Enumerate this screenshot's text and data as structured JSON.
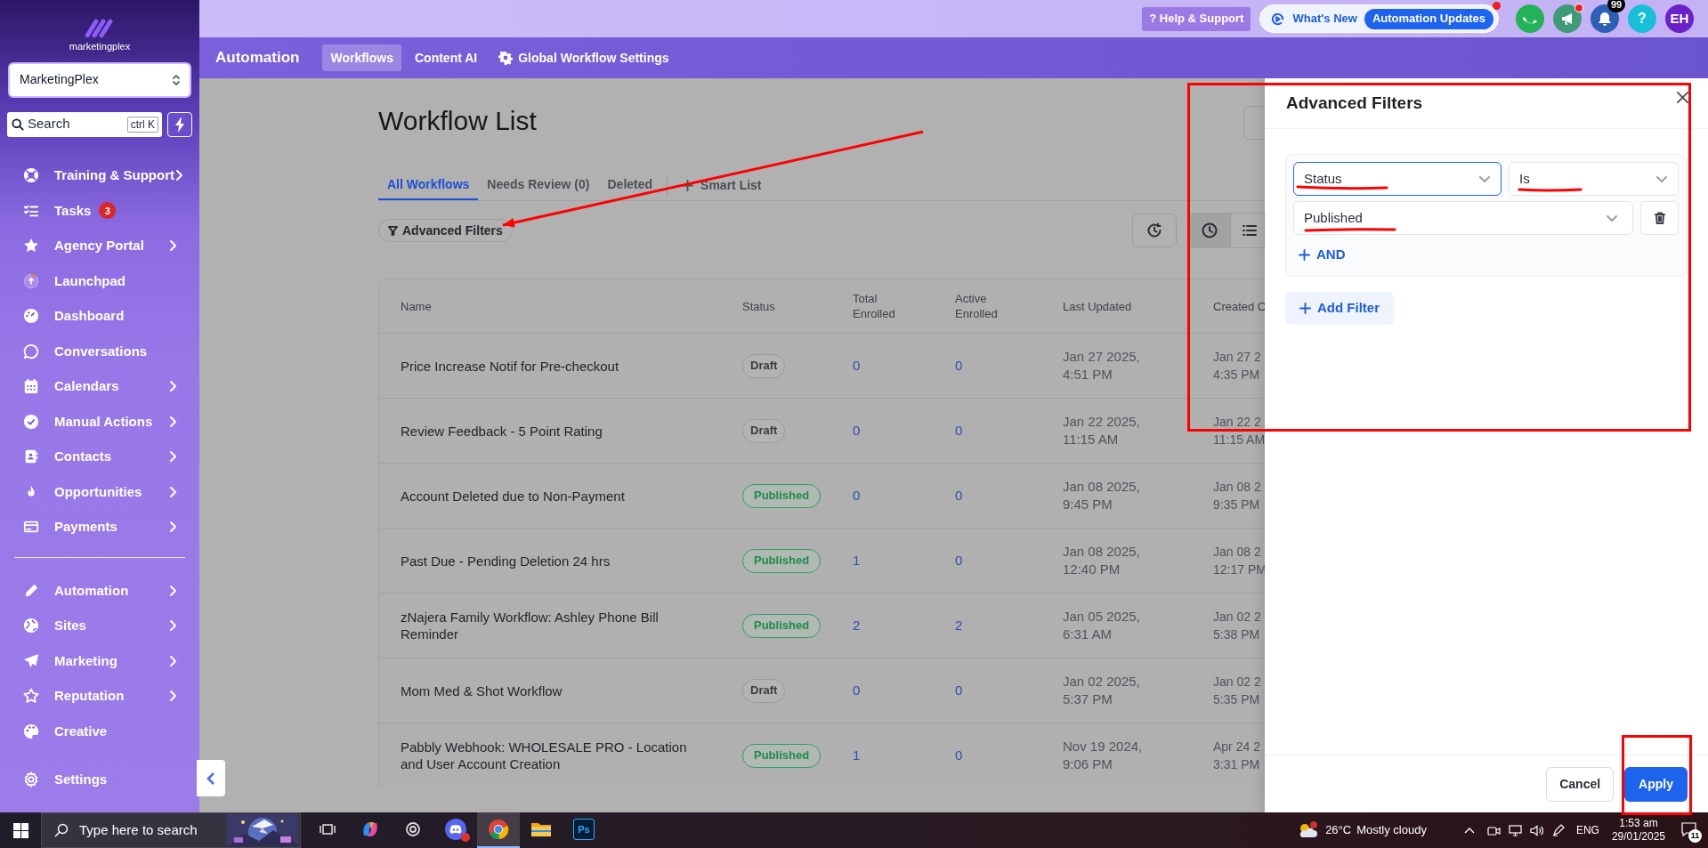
{
  "sidebar": {
    "logo": "marketingplex",
    "account": "MarketingPlex",
    "search": {
      "placeholder": "Search",
      "shortcut": "ctrl K"
    },
    "sections": [
      {
        "divider_before": false,
        "items": [
          {
            "label": "Training & Support",
            "submenu": true
          },
          {
            "label": "Tasks",
            "submenu": false,
            "badge": "3"
          },
          {
            "label": "Agency Portal",
            "submenu": true
          },
          {
            "label": "Launchpad",
            "submenu": false
          },
          {
            "label": "Dashboard",
            "submenu": false
          },
          {
            "label": "Conversations",
            "submenu": false
          },
          {
            "label": "Calendars",
            "submenu": true
          },
          {
            "label": "Manual Actions",
            "submenu": true
          },
          {
            "label": "Contacts",
            "submenu": true
          },
          {
            "label": "Opportunities",
            "submenu": true
          },
          {
            "label": "Payments",
            "submenu": true
          }
        ]
      },
      {
        "divider_before": true,
        "items": [
          {
            "label": "Automation",
            "submenu": true
          },
          {
            "label": "Sites",
            "submenu": true
          },
          {
            "label": "Marketing",
            "submenu": true
          },
          {
            "label": "Reputation",
            "submenu": true
          },
          {
            "label": "Creative",
            "submenu": false
          }
        ]
      },
      {
        "divider_before": false,
        "items": [
          {
            "label": "Settings",
            "submenu": false
          }
        ]
      }
    ]
  },
  "topbar": {
    "help": "? Help & Support",
    "whats_new": {
      "label": "What's New",
      "badge": "Automation Updates",
      "dot": true
    },
    "actions": [
      {
        "kind": "phone",
        "color": "#22b35a"
      },
      {
        "kind": "announce",
        "color": "#3f9a78",
        "dot": true
      },
      {
        "kind": "notifications",
        "color": "#2c5fb5",
        "badge": "99"
      },
      {
        "kind": "help",
        "color": "#17c0d8",
        "text": "?"
      },
      {
        "kind": "avatar",
        "color": "#6b21c8",
        "text": "EH"
      }
    ]
  },
  "subnav": {
    "title": "Automation",
    "tabs": [
      {
        "label": "Workflows",
        "selected": true,
        "gear": false
      },
      {
        "label": "Content AI",
        "selected": false,
        "gear": false
      },
      {
        "label": "Global Workflow Settings",
        "selected": false,
        "gear": true
      }
    ]
  },
  "page": {
    "title": "Workflow List",
    "tabs": [
      {
        "label": "All Workflows",
        "selected": true
      },
      {
        "label": "Needs Review (0)",
        "selected": false
      },
      {
        "label": "Deleted",
        "selected": false
      }
    ],
    "smart_list": "Smart List",
    "filter_button": "Advanced Filters",
    "view_toggle": [
      {
        "selected": true
      },
      {
        "selected": false
      }
    ],
    "table": {
      "columns": [
        "Name",
        "Status",
        "Total Enrolled",
        "Active Enrolled",
        "Last Updated",
        "Created O"
      ],
      "rows": [
        {
          "name": "Price Increase Notif for Pre-checkout",
          "status": {
            "label": "Draft",
            "kind": "draft"
          },
          "total": "0",
          "active": "0",
          "updated": [
            "Jan 27 2025,",
            "4:51 PM"
          ],
          "created": [
            "Jan 27 2",
            "4:35 PM"
          ]
        },
        {
          "name": "Review Feedback - 5 Point Rating",
          "status": {
            "label": "Draft",
            "kind": "draft"
          },
          "total": "0",
          "active": "0",
          "updated": [
            "Jan 22 2025,",
            "11:15 AM"
          ],
          "created": [
            "Jan 22 2",
            "11:15 AM"
          ]
        },
        {
          "name": "Account Deleted due to Non-Payment",
          "status": {
            "label": "Published",
            "kind": "published"
          },
          "total": "0",
          "active": "0",
          "updated": [
            "Jan 08 2025,",
            "9:45 PM"
          ],
          "created": [
            "Jan 08 2",
            "9:35 PM"
          ]
        },
        {
          "name": "Past Due - Pending Deletion 24 hrs",
          "status": {
            "label": "Published",
            "kind": "published"
          },
          "total": "1",
          "active": "0",
          "updated": [
            "Jan 08 2025,",
            "12:40 PM"
          ],
          "created": [
            "Jan 08 2",
            "12:17 PM"
          ]
        },
        {
          "name": "zNajera Family Workflow: Ashley Phone Bill Reminder",
          "status": {
            "label": "Published",
            "kind": "published"
          },
          "total": "2",
          "active": "2",
          "updated": [
            "Jan 05 2025,",
            "6:31 AM"
          ],
          "created": [
            "Jan 02 2",
            "5:38 PM"
          ]
        },
        {
          "name": "Mom Med & Shot Workflow",
          "status": {
            "label": "Draft",
            "kind": "draft"
          },
          "total": "0",
          "active": "0",
          "updated": [
            "Jan 02 2025,",
            "5:37 PM"
          ],
          "created": [
            "Jan 02 2",
            "5:35 PM"
          ]
        },
        {
          "name": "Pabbly Webhook: WHOLESALE PRO - Location and User Account Creation",
          "status": {
            "label": "Published",
            "kind": "published"
          },
          "total": "1",
          "active": "0",
          "updated": [
            "Nov 19 2024,",
            "9:06 PM"
          ],
          "created": [
            "Apr 24 2",
            "3:31 PM"
          ]
        }
      ]
    }
  },
  "drawer": {
    "title": "Advanced Filters",
    "filters": [
      {
        "field": "Status",
        "operator": "Is",
        "value": "Published",
        "field_focused": true
      }
    ],
    "and_label": "AND",
    "add_filter": "Add Filter",
    "cancel": "Cancel",
    "apply": "Apply"
  },
  "markup": [
    {
      "kind": "box"
    },
    {
      "kind": "box"
    },
    {
      "kind": "arrow"
    },
    {
      "kind": "underline"
    },
    {
      "kind": "underline"
    },
    {
      "kind": "underline"
    }
  ],
  "taskbar": {
    "search_placeholder": "Type here to search",
    "apps": [
      {
        "kind": "task-view",
        "selected": false
      },
      {
        "kind": "copilot",
        "selected": false
      },
      {
        "kind": "app",
        "selected": false
      },
      {
        "kind": "chat",
        "selected": false
      },
      {
        "kind": "browser",
        "selected": true
      },
      {
        "kind": "folder",
        "selected": false
      },
      {
        "kind": "photoshop",
        "label": "Ps",
        "selected": false
      }
    ],
    "temperature": "26°C",
    "weather": "Mostly cloudy",
    "language": "ENG",
    "time": "1:53 am",
    "date": "29/01/2025",
    "notifications": "11"
  }
}
